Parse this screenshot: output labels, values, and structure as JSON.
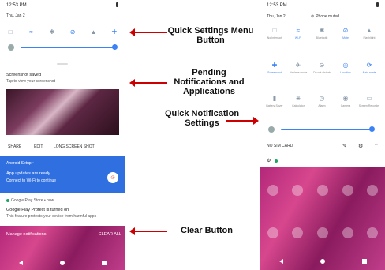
{
  "left_phone": {
    "time": "12:53 PM",
    "date": "Thu, Jan 2",
    "notification_screenshot": {
      "title": "Screenshot saved",
      "subtitle": "Tap to view your screenshot",
      "actions": [
        "SHARE",
        "EDIT",
        "LONG SCREEN SHOT"
      ]
    },
    "notification_setup": {
      "app": "Android Setup •",
      "title": "App updates are ready",
      "subtitle": "Connect to Wi-Fi to continue"
    },
    "notification_play": {
      "app": "Google Play Store • now",
      "title": "Google Play Protect is turned on",
      "subtitle": "This feature protects your device from harmful apps"
    },
    "manage_label": "Manage notifications",
    "clear_label": "CLEAR ALL"
  },
  "right_phone": {
    "time": "12:53 PM",
    "date": "Thu, Jan 2",
    "phone_status": "Phone muted",
    "tiles_row1": [
      {
        "label": "No Interrupt",
        "icon": "dnd-icon",
        "on": false
      },
      {
        "label": "Wi-Fi",
        "icon": "wifi-icon",
        "on": true
      },
      {
        "label": "Bluetooth",
        "icon": "bluetooth-icon",
        "on": false
      },
      {
        "label": "Mute",
        "icon": "mute-icon",
        "on": true
      },
      {
        "label": "Flashlight",
        "icon": "flashlight-icon",
        "on": false
      }
    ],
    "tiles_row2": [
      {
        "label": "Screenshot",
        "icon": "screenshot-icon",
        "on": true
      },
      {
        "label": "Airplane mode",
        "icon": "airplane-icon",
        "on": false
      },
      {
        "label": "Do not disturb",
        "icon": "do-not-disturb-icon",
        "on": false
      },
      {
        "label": "Location",
        "icon": "location-icon",
        "on": true
      },
      {
        "label": "Auto-rotate",
        "icon": "rotate-icon",
        "on": true
      }
    ],
    "tiles_row3": [
      {
        "label": "Battery Saver",
        "icon": "battery-icon",
        "on": false
      },
      {
        "label": "Calculator",
        "icon": "calculator-icon",
        "on": false
      },
      {
        "label": "Alarm",
        "icon": "alarm-icon",
        "on": false
      },
      {
        "label": "Camera",
        "icon": "camera-icon",
        "on": false
      },
      {
        "label": "Screen Recorder",
        "icon": "screen-recorder-icon",
        "on": false
      }
    ],
    "sim_label": "NO SIM CARD"
  },
  "annotations": {
    "quick_settings": "Quick Settings Menu Button",
    "pending": "Pending Notifications and Applications",
    "quick_notification": "Quick Notification Settings",
    "clear": "Clear Button"
  },
  "colors": {
    "accent": "#3b82f6",
    "arrow": "#cc0000",
    "setup_card": "#2f6fe0"
  }
}
